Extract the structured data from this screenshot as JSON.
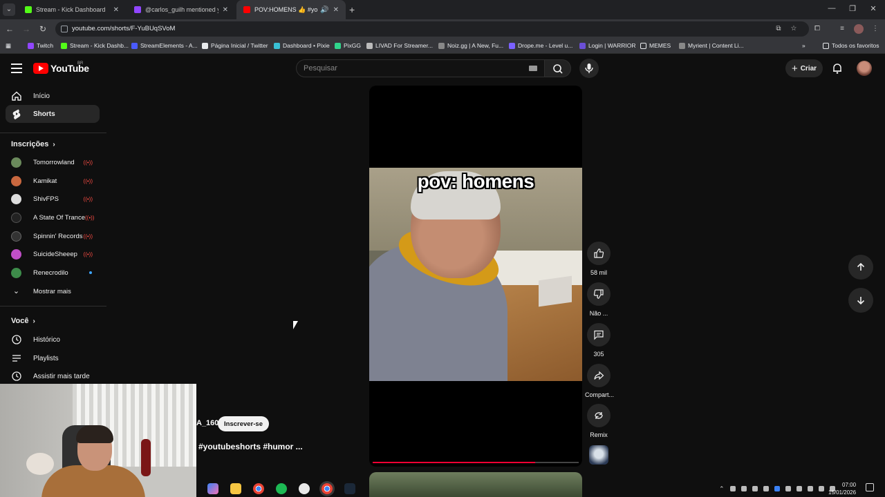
{
  "browser": {
    "tabs": [
      {
        "title": "Stream - Kick Dashboard",
        "favicon_color": "#53fc18"
      },
      {
        "title": "@carlos_guilh mentioned y",
        "favicon_color": "#9146ff"
      },
      {
        "title": "POV:HOMENS 👍 #youtube",
        "favicon_color": "#ff0000"
      }
    ],
    "url": "youtube.com/shorts/F-YuBUqSVoM",
    "bookmarks": [
      {
        "label": "Twitch",
        "color": "#9146ff"
      },
      {
        "label": "Stream - Kick Dashb...",
        "color": "#53fc18"
      },
      {
        "label": "StreamElements - A...",
        "color": "#4a5bff"
      },
      {
        "label": "Página Inicial / Twitter",
        "color": "#e8eaed"
      },
      {
        "label": "Dashboard • Pixie",
        "color": "#39c1d6"
      },
      {
        "label": "PixGG",
        "color": "#30d58c"
      },
      {
        "label": "LIVAD For Streamer...",
        "color": "#bbbbbb"
      },
      {
        "label": "Noiz.gg | A New, Fu...",
        "color": "#888888"
      },
      {
        "label": "Drope.me - Level u...",
        "color": "#7b61ff"
      },
      {
        "label": "Login | WARRIOR",
        "color": "#6b4fd6"
      },
      {
        "label": "MEMES",
        "color": "#e8eaed"
      },
      {
        "label": "Myrient | Content Li...",
        "color": "#888888"
      }
    ],
    "all_bookmarks_label": "Todos os favoritos"
  },
  "header": {
    "logo_text": "YouTube",
    "country_code": "BR",
    "search_placeholder": "Pesquisar",
    "create_label": "Criar"
  },
  "sidebar": {
    "main": [
      {
        "label": "Início",
        "icon": "home-icon"
      },
      {
        "label": "Shorts",
        "icon": "shorts-icon"
      }
    ],
    "subscriptions_heading": "Inscrições",
    "subscriptions": [
      {
        "name": "Tomorrowland",
        "status": "live",
        "color": "#6b8a5c"
      },
      {
        "name": "Kamikat",
        "status": "live",
        "color": "#c9683f"
      },
      {
        "name": "ShivFPS",
        "status": "live",
        "color": "#dddddd"
      },
      {
        "name": "A State Of Trance",
        "status": "live",
        "color": "#222222"
      },
      {
        "name": "Spinnin' Records",
        "status": "live",
        "color": "#333333"
      },
      {
        "name": "SuicideSheeep",
        "status": "live",
        "color": "#c04fc7"
      },
      {
        "name": "Renecrodilo",
        "status": "new",
        "color": "#3d8c4a"
      }
    ],
    "show_more_label": "Mostrar mais",
    "you_heading": "Você",
    "you_items": [
      {
        "label": "Histórico",
        "icon": "history-icon"
      },
      {
        "label": "Playlists",
        "icon": "playlists-icon"
      },
      {
        "label": "Assistir mais tarde",
        "icon": "watch-later-icon"
      }
    ]
  },
  "short": {
    "caption": "pov: homens",
    "channel_handle": "A_160",
    "subscribe_label": "Inscrever-se",
    "title": "#youtubeshorts #humor ...",
    "progress": 0.79,
    "actions": {
      "like_count": "58 mil",
      "dislike_label": "Não ...",
      "comment_count": "305",
      "share_label": "Compart...",
      "remix_label": "Remix"
    }
  },
  "system": {
    "time": "07:00",
    "date": "15/01/2026"
  }
}
